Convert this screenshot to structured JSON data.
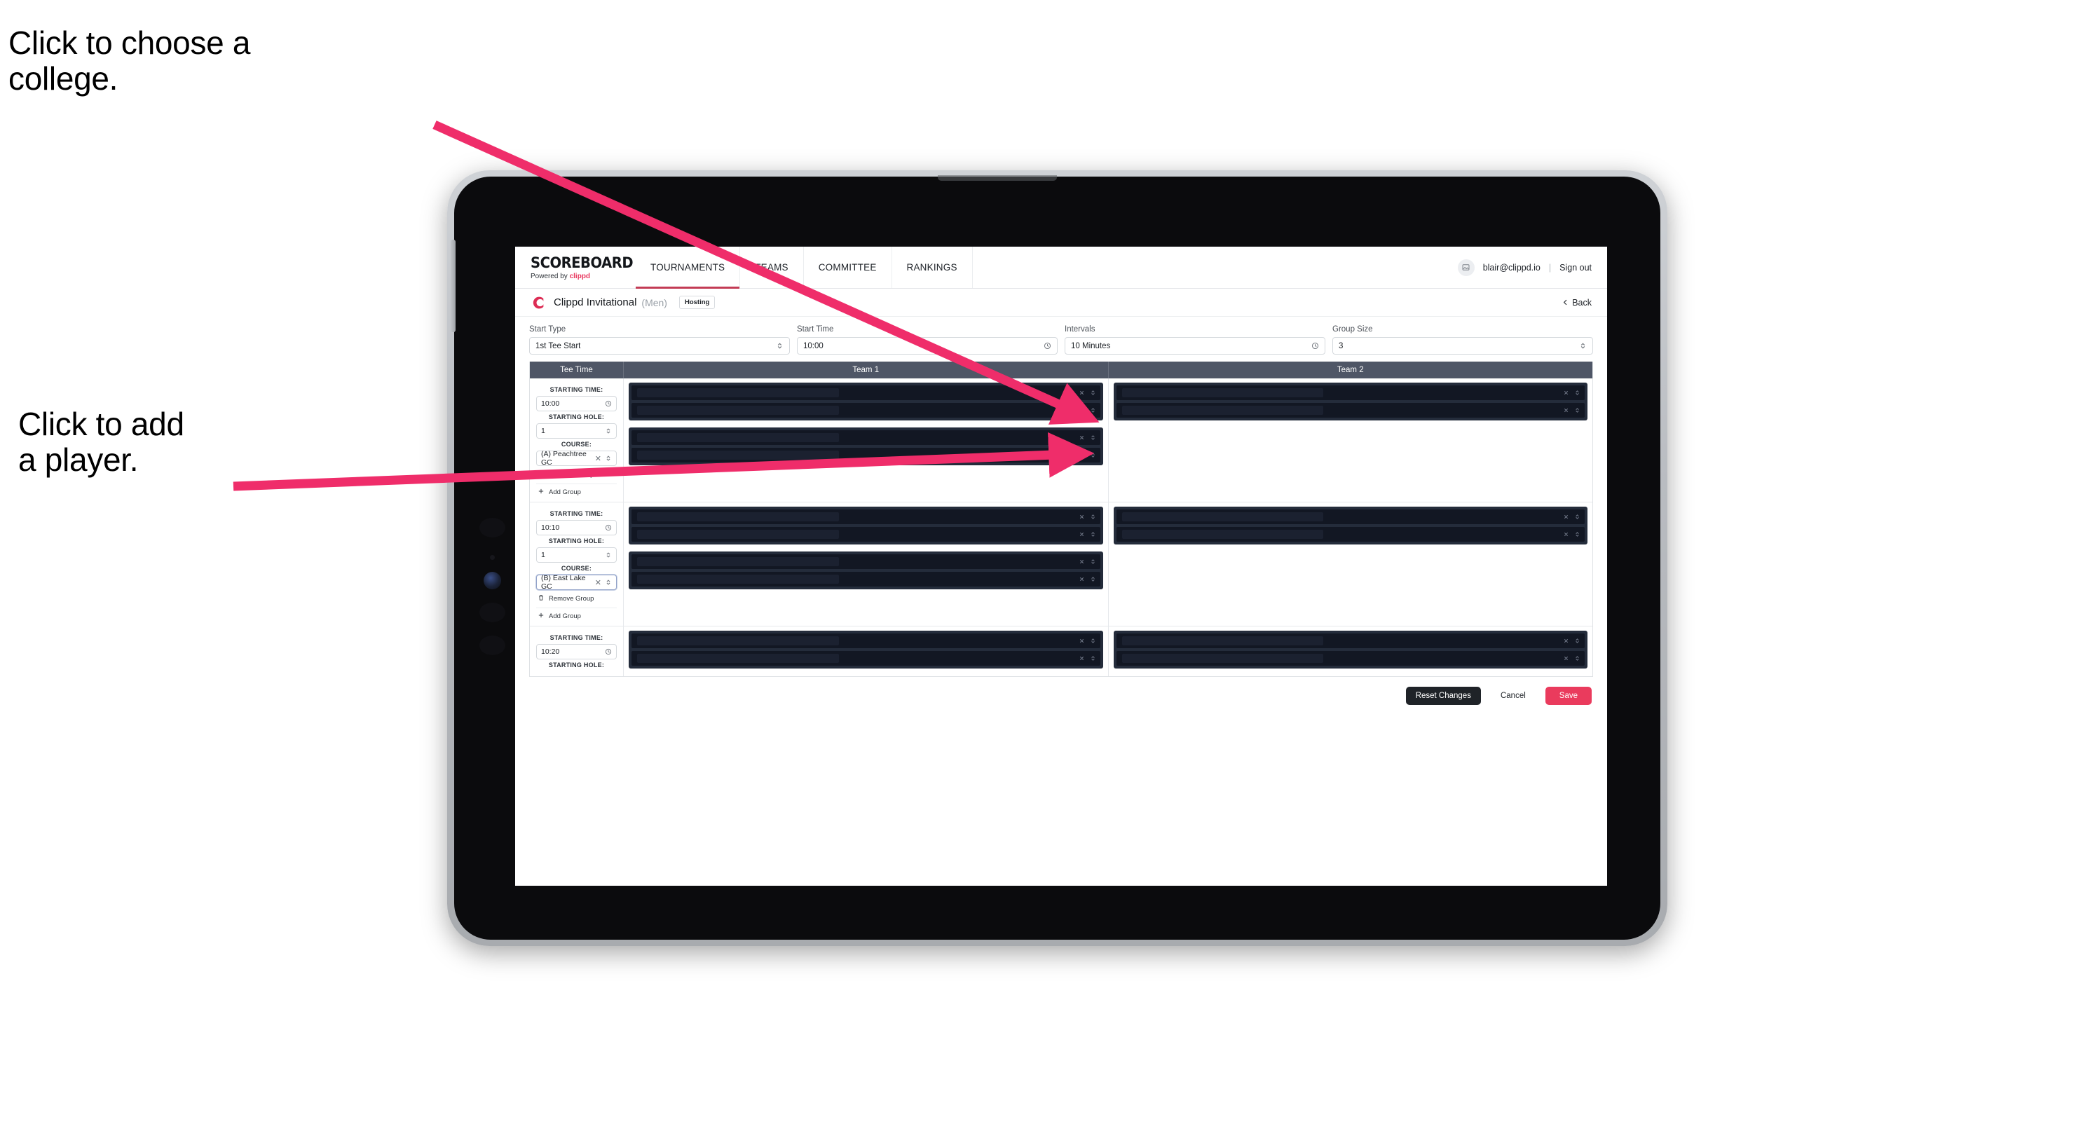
{
  "annotations": [
    {
      "id": "choose-college",
      "text": "Click to choose a\ncollege."
    },
    {
      "id": "add-player",
      "text": "Click to add\na player."
    }
  ],
  "colors": {
    "accent_pink": "#ea3b5d",
    "brand_pink": "#e8365d",
    "nav_underline": "#c33b55",
    "table_header_bg": "#4f5666",
    "player_group_bg": "#242c3b",
    "player_slot_bg": "#121723",
    "reset_button_bg": "#1f2328",
    "annotation_arrow": "#ef2d6a"
  },
  "app": {
    "brand": {
      "name": "SCOREBOARD",
      "powered_prefix": "Powered by",
      "powered_brand": "clippd"
    },
    "nav_tabs": [
      {
        "label": "TOURNAMENTS",
        "active": true
      },
      {
        "label": "TEAMS",
        "active": false
      },
      {
        "label": "COMMITTEE",
        "active": false
      },
      {
        "label": "RANKINGS",
        "active": false
      }
    ],
    "account": {
      "email": "blair@clippd.io",
      "separator": "|",
      "sign_out": "Sign out",
      "avatar_icon": "user-image-icon"
    },
    "title_bar": {
      "logo_icon": "clippd-c-logo",
      "tournament_name": "Clippd Invitational",
      "gender": "(Men)",
      "badge": "Hosting",
      "back_label": "Back",
      "back_icon": "chevron-left-icon"
    },
    "controls": [
      {
        "label": "Start Type",
        "value": "1st Tee Start",
        "icon": "updown-chevron-icon"
      },
      {
        "label": "Start Time",
        "value": "10:00",
        "icon": "clock-icon"
      },
      {
        "label": "Intervals",
        "value": "10 Minutes",
        "icon": "clock-icon"
      },
      {
        "label": "Group Size",
        "value": "3",
        "icon": "updown-chevron-icon"
      }
    ],
    "table": {
      "headers": {
        "tee_time": "Tee Time",
        "team1": "Team 1",
        "team2": "Team 2"
      },
      "field_labels": {
        "starting_time": "STARTING TIME:",
        "starting_hole": "STARTING HOLE:",
        "course": "COURSE:"
      },
      "group_actions": {
        "remove": "Remove Group",
        "remove_icon": "trash-icon",
        "add": "Add Group",
        "add_icon": "plus-icon"
      },
      "slot_icons": {
        "clear": "close-x-icon",
        "dropdown": "updown-chevron-icon"
      },
      "rows": [
        {
          "starting_time": "10:00",
          "starting_hole": "1",
          "course": "(A) Peachtree GC",
          "course_focused": false,
          "show_group_actions": true,
          "team1_groups": [
            {
              "slots": 2
            },
            {
              "slots": 2
            }
          ],
          "team2_groups": [
            {
              "slots": 2
            }
          ]
        },
        {
          "starting_time": "10:10",
          "starting_hole": "1",
          "course": "(B) East Lake GC",
          "course_focused": true,
          "show_group_actions": true,
          "team1_groups": [
            {
              "slots": 2
            },
            {
              "slots": 2
            }
          ],
          "team2_groups": [
            {
              "slots": 2
            }
          ]
        },
        {
          "starting_time": "10:20",
          "starting_hole": "",
          "course": "",
          "course_focused": false,
          "show_group_actions": false,
          "team1_groups": [
            {
              "slots": 2
            }
          ],
          "team2_groups": [
            {
              "slots": 2
            }
          ]
        }
      ]
    },
    "footer": {
      "reset": "Reset Changes",
      "cancel": "Cancel",
      "save": "Save"
    }
  }
}
